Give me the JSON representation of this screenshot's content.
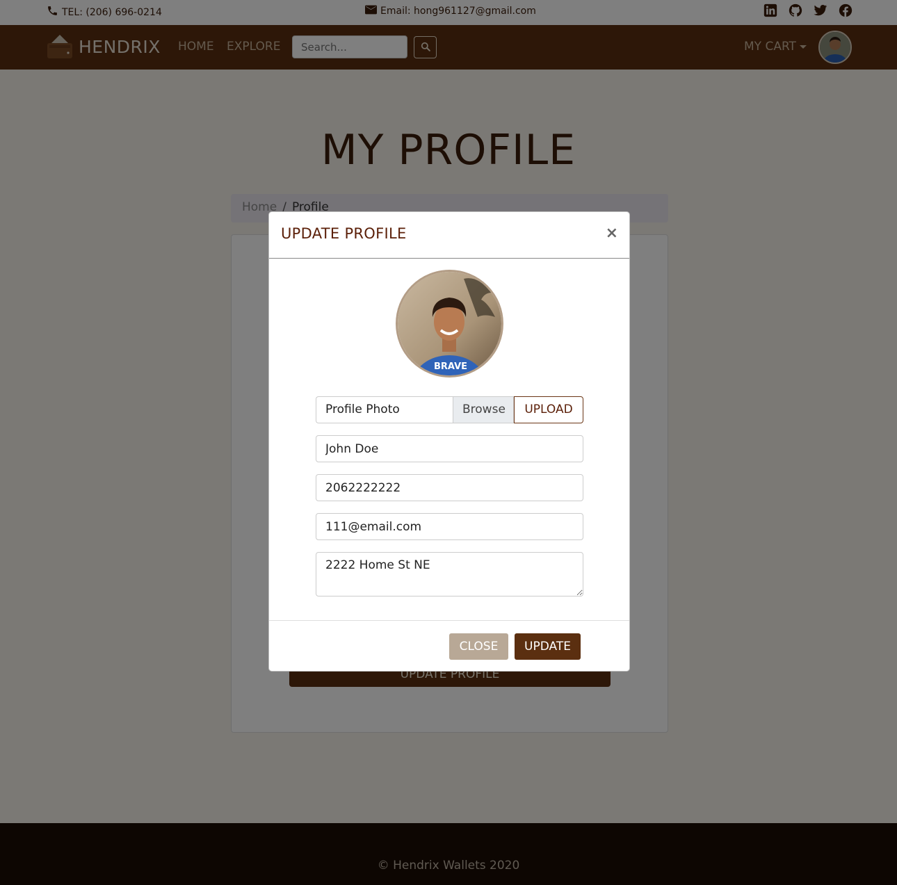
{
  "topbar": {
    "tel": "TEL: (206) 696-0214",
    "email": "Email: hong961127@gmail.com",
    "socials": [
      "linkedin-icon",
      "github-icon",
      "twitter-icon",
      "facebook-icon"
    ]
  },
  "navbar": {
    "brand": "HENDRIX",
    "links": [
      "HOME",
      "EXPLORE"
    ],
    "search_placeholder": "Search...",
    "cart": "MY CART"
  },
  "page": {
    "title": "MY PROFILE",
    "breadcrumb": [
      "Home",
      "/",
      "Profile"
    ],
    "card_button": "UPDATE PROFILE"
  },
  "modal": {
    "title": "UPDATE PROFILE",
    "close_symbol": "×",
    "photo_label": "Profile Photo",
    "browse": "Browse",
    "upload": "UPLOAD",
    "name": "John Doe",
    "phone": "2062222222",
    "email": "111@email.com",
    "address": "2222 Home St NE",
    "close_button": "CLOSE",
    "update_button": "UPDATE"
  },
  "footer": {
    "copyright": "© Hendrix Wallets 2020"
  },
  "colors": {
    "brand_brown": "#5b2f10",
    "title_brown": "#3b1d0a",
    "footer_dark": "#1a0d05"
  }
}
